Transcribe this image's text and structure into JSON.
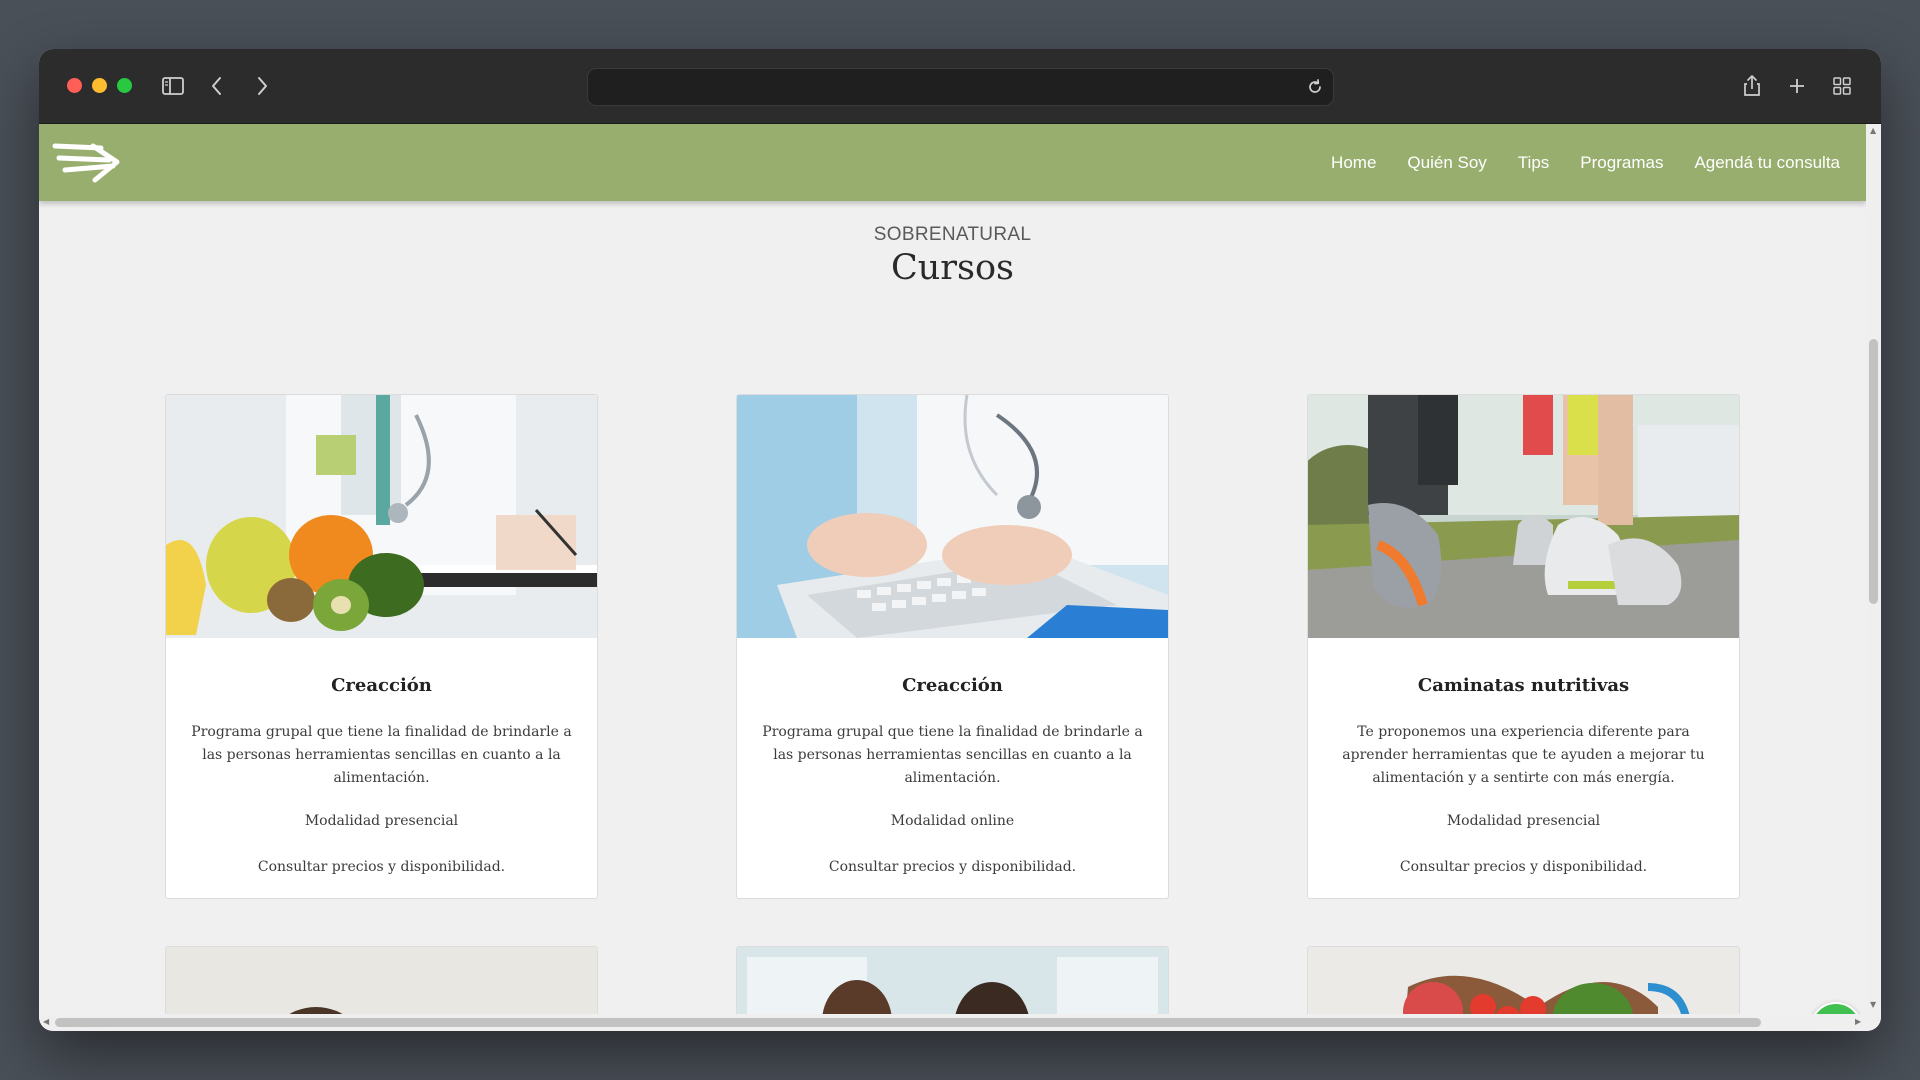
{
  "browser": {
    "address_value": ""
  },
  "site": {
    "nav": [
      "Home",
      "Quién Soy",
      "Tips",
      "Programas",
      "Agendá tu consulta"
    ],
    "header_color": "#98ae6e"
  },
  "section": {
    "eyebrow": "SOBRENATURAL",
    "title": "Cursos"
  },
  "courses": [
    {
      "title": "Creacción",
      "description": "Programa grupal que tiene la finalidad de brindarle a las personas herramientas sencillas en cuanto a la alimentación.",
      "mode": "Modalidad presencial",
      "price_note": "Consultar precios y disponibilidad.",
      "image": "nutritionist-with-fruits-photo"
    },
    {
      "title": "Creacción",
      "description": "Programa grupal que tiene la finalidad de brindarle a las personas herramientas sencillas en cuanto a la alimentación.",
      "mode": "Modalidad online",
      "price_note": "Consultar precios y disponibilidad.",
      "image": "doctor-typing-laptop-photo"
    },
    {
      "title": "Caminatas nutritivas",
      "description": "Te proponemos una experiencia diferente para aprender herramientas que te ayuden a mejorar tu alimentación y a sentirte con más energía.",
      "mode": "Modalidad presencial",
      "price_note": "Consultar precios y disponibilidad.",
      "image": "walking-sneakers-photo"
    }
  ],
  "more_courses_images": [
    "child-with-vegetables-photo",
    "nutrition-consultation-photo",
    "heart-bowl-vegetables-photo"
  ],
  "icons": {
    "whatsapp": "whatsapp-icon",
    "logo": "brand-logo-icon"
  }
}
